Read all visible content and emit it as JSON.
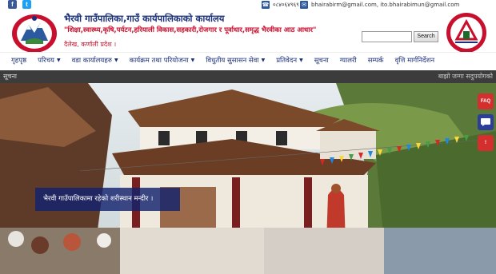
{
  "topbar": {
    "phone": "०८४०६४९६९",
    "email": "bhairabirm@gmail.com, ito.bhairabimun@gmail.com"
  },
  "header": {
    "title": "भैरवी गाउँपालिका,गाउँ कार्यपालिकाको कार्यालय",
    "slogan": "\"शिक्षा,स्वास्थ्य,कृषि,पर्यटन,हरियाली विकास,सहकारी,रोजगार र पूर्वाधार,समृद्ध भैरवीका आठ आधार\"",
    "address": "दैलेख, कर्णाली प्रदेश ।",
    "search_button": "Search",
    "search_placeholder": ""
  },
  "nav": {
    "items": [
      {
        "label": "गृहपृष्ठ",
        "dropdown": false
      },
      {
        "label": "परिचय",
        "dropdown": true
      },
      {
        "label": "वडा कार्यालयहरु",
        "dropdown": true
      },
      {
        "label": "कार्यक्रम तथा परियोजना",
        "dropdown": true
      },
      {
        "label": "विधुतीय सुसासन सेवा",
        "dropdown": true
      },
      {
        "label": "प्रतिवेदन",
        "dropdown": true
      },
      {
        "label": "सूचना",
        "dropdown": false
      },
      {
        "label": "ग्यालरी",
        "dropdown": false
      },
      {
        "label": "सम्पर्क",
        "dropdown": false
      },
      {
        "label": "वृत्ति मार्गनिर्देशन",
        "dropdown": false
      }
    ]
  },
  "ticker": {
    "label": "सूचना",
    "text": "बाझो जग्गा सदुपयोगको"
  },
  "hero": {
    "caption": "भैरवी गाउँपालिकामा रहेको शरीस्थान मन्दीर ।"
  },
  "side_buttons": [
    {
      "name": "faq",
      "label": "FAQ",
      "color": "#d32f2f"
    },
    {
      "name": "chat",
      "label": "",
      "color": "#2c3e9a"
    },
    {
      "name": "alert",
      "label": "!",
      "color": "#d32f2f"
    }
  ],
  "colors": {
    "brand_blue": "#1a2f7a",
    "brand_red": "#c8102e",
    "ticker_bg": "#3c3c3c"
  }
}
